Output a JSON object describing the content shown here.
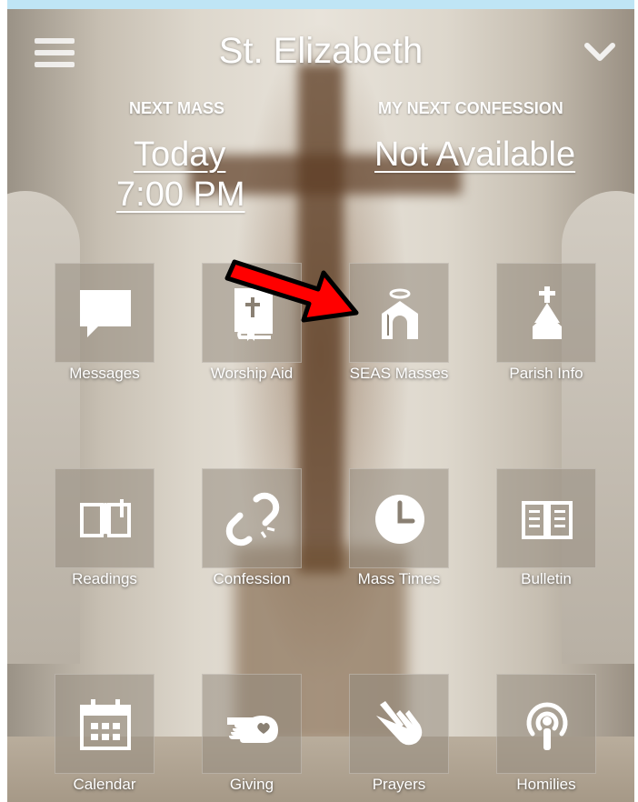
{
  "header": {
    "title": "St. Elizabeth",
    "menu_icon": "hamburger-menu-icon",
    "dropdown_icon": "chevron-down-icon"
  },
  "info": {
    "next_mass_label": "NEXT MASS",
    "next_mass_day": "Today",
    "next_mass_time": "7:00 PM",
    "confession_label": "MY NEXT CONFESSION",
    "confession_value": "Not Available"
  },
  "tiles": [
    {
      "label": "Messages",
      "icon": "chat-bubble-icon"
    },
    {
      "label": "Worship Aid",
      "icon": "book-icon"
    },
    {
      "label": "SEAS Masses",
      "icon": "church-halo-icon"
    },
    {
      "label": "Parish Info",
      "icon": "church-steeple-icon"
    },
    {
      "label": "Readings",
      "icon": "open-book-icon"
    },
    {
      "label": "Confession",
      "icon": "broken-chain-icon"
    },
    {
      "label": "Mass Times",
      "icon": "clock-icon"
    },
    {
      "label": "Bulletin",
      "icon": "newspaper-book-icon"
    },
    {
      "label": "Calendar",
      "icon": "calendar-icon"
    },
    {
      "label": "Giving",
      "icon": "hand-heart-icon"
    },
    {
      "label": "Prayers",
      "icon": "praying-hands-icon"
    },
    {
      "label": "Homilies",
      "icon": "podcast-icon"
    }
  ],
  "colors": {
    "top_bar": "#bfe5f5",
    "arrow": "#ff0000",
    "tile_text": "#ffffff"
  }
}
